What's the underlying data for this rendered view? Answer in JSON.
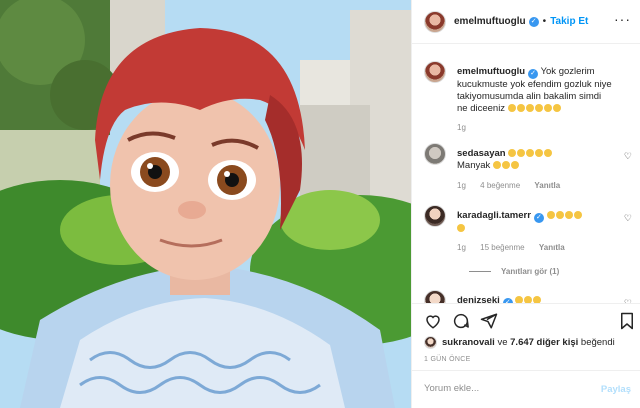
{
  "post": {
    "username": "emelmuftuoglu",
    "follow_label": "Takip Et",
    "caption": "Yok gozlerim kucukmuste yok efendim gozluk niye takiyomusumda alin bakalim simdi ne diceeniz",
    "caption_time": "1g"
  },
  "comments": [
    {
      "username": "sedasayan",
      "text": "Manyak",
      "time": "1g",
      "likes": "4 beğenme",
      "reply": "Yanıtla"
    },
    {
      "username": "karadagli.tamerr",
      "text": "",
      "time": "1g",
      "likes": "15 beğenme",
      "reply": "Yanıtla",
      "view_replies": "Yanıtları gör (1)"
    },
    {
      "username": "denizseki",
      "text": ""
    }
  ],
  "likes_bar": {
    "liker": "sukranovali",
    "connector": "ve",
    "others": "7.647 diğer kişi",
    "suffix": "beğendi",
    "ago": "1 GÜN ÖNCE"
  },
  "comment_box": {
    "placeholder": "Yorum ekle...",
    "post_label": "Paylaş"
  },
  "colors": {
    "accent": "#0095f6",
    "verified": "#3897f0",
    "muted": "#8e8e8e"
  },
  "icons": [
    "more-icon",
    "heart-icon",
    "comment-icon",
    "share-icon",
    "bookmark-icon",
    "verified-icon"
  ]
}
